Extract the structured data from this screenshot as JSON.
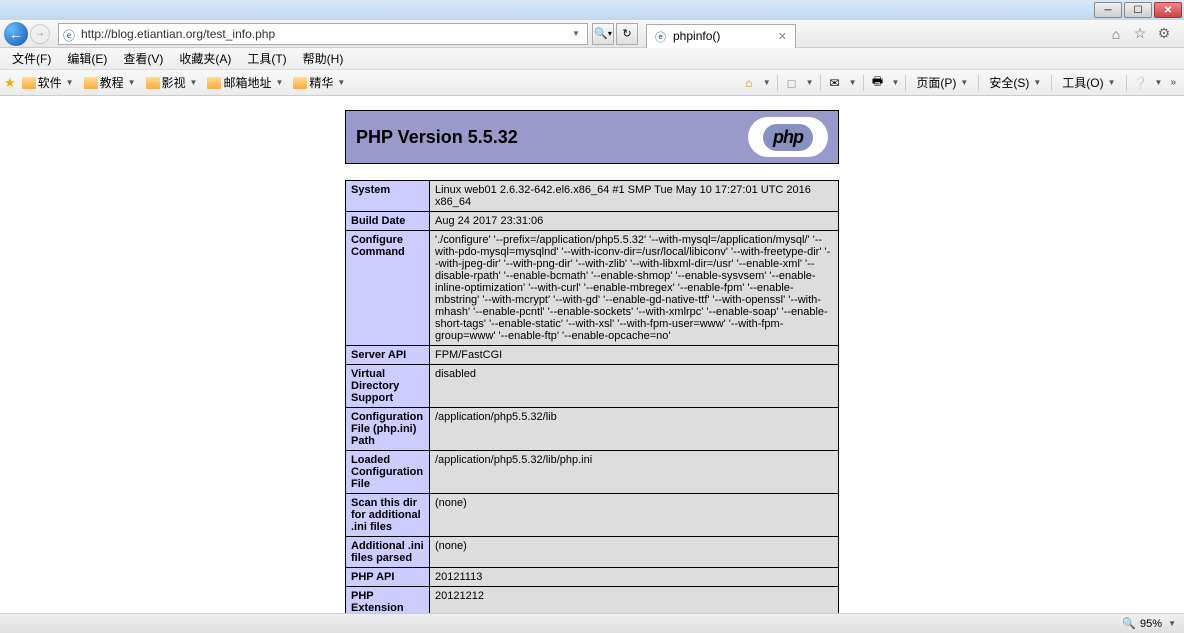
{
  "window": {
    "url": "http://blog.etiantian.org/test_info.php",
    "tab_title": "phpinfo()"
  },
  "menubar": {
    "file": "文件(F)",
    "edit": "编辑(E)",
    "view": "查看(V)",
    "favorites": "收藏夹(A)",
    "tools": "工具(T)",
    "help": "帮助(H)"
  },
  "bookmarks": {
    "left": [
      {
        "label": "软件"
      },
      {
        "label": "教程"
      },
      {
        "label": "影视"
      },
      {
        "label": "邮箱地址"
      },
      {
        "label": "精华"
      }
    ],
    "right": {
      "page": "页面(P)",
      "safety": "安全(S)",
      "tools": "工具(O)"
    }
  },
  "php": {
    "version_title": "PHP Version 5.5.32",
    "logo_text": "php",
    "rows": [
      {
        "label": "System",
        "value": "Linux web01 2.6.32-642.el6.x86_64 #1 SMP Tue May 10 17:27:01 UTC 2016 x86_64"
      },
      {
        "label": "Build Date",
        "value": "Aug 24 2017 23:31:06"
      },
      {
        "label": "Configure Command",
        "value": "'./configure' '--prefix=/application/php5.5.32' '--with-mysql=/application/mysql/' '--with-pdo-mysql=mysqlnd' '--with-iconv-dir=/usr/local/libiconv' '--with-freetype-dir' '--with-jpeg-dir' '--with-png-dir' '--with-zlib' '--with-libxml-dir=/usr' '--enable-xml' '--disable-rpath' '--enable-bcmath' '--enable-shmop' '--enable-sysvsem' '--enable-inline-optimization' '--with-curl' '--enable-mbregex' '--enable-fpm' '--enable-mbstring' '--with-mcrypt' '--with-gd' '--enable-gd-native-ttf' '--with-openssl' '--with-mhash' '--enable-pcntl' '--enable-sockets' '--with-xmlrpc' '--enable-soap' '--enable-short-tags' '--enable-static' '--with-xsl' '--with-fpm-user=www' '--with-fpm-group=www' '--enable-ftp' '--enable-opcache=no'"
      },
      {
        "label": "Server API",
        "value": "FPM/FastCGI"
      },
      {
        "label": "Virtual Directory Support",
        "value": "disabled"
      },
      {
        "label": "Configuration File (php.ini) Path",
        "value": "/application/php5.5.32/lib"
      },
      {
        "label": "Loaded Configuration File",
        "value": "/application/php5.5.32/lib/php.ini"
      },
      {
        "label": "Scan this dir for additional .ini files",
        "value": "(none)"
      },
      {
        "label": "Additional .ini files parsed",
        "value": "(none)"
      },
      {
        "label": "PHP API",
        "value": "20121113"
      },
      {
        "label": "PHP Extension",
        "value": "20121212"
      }
    ]
  },
  "statusbar": {
    "zoom": "95%"
  }
}
